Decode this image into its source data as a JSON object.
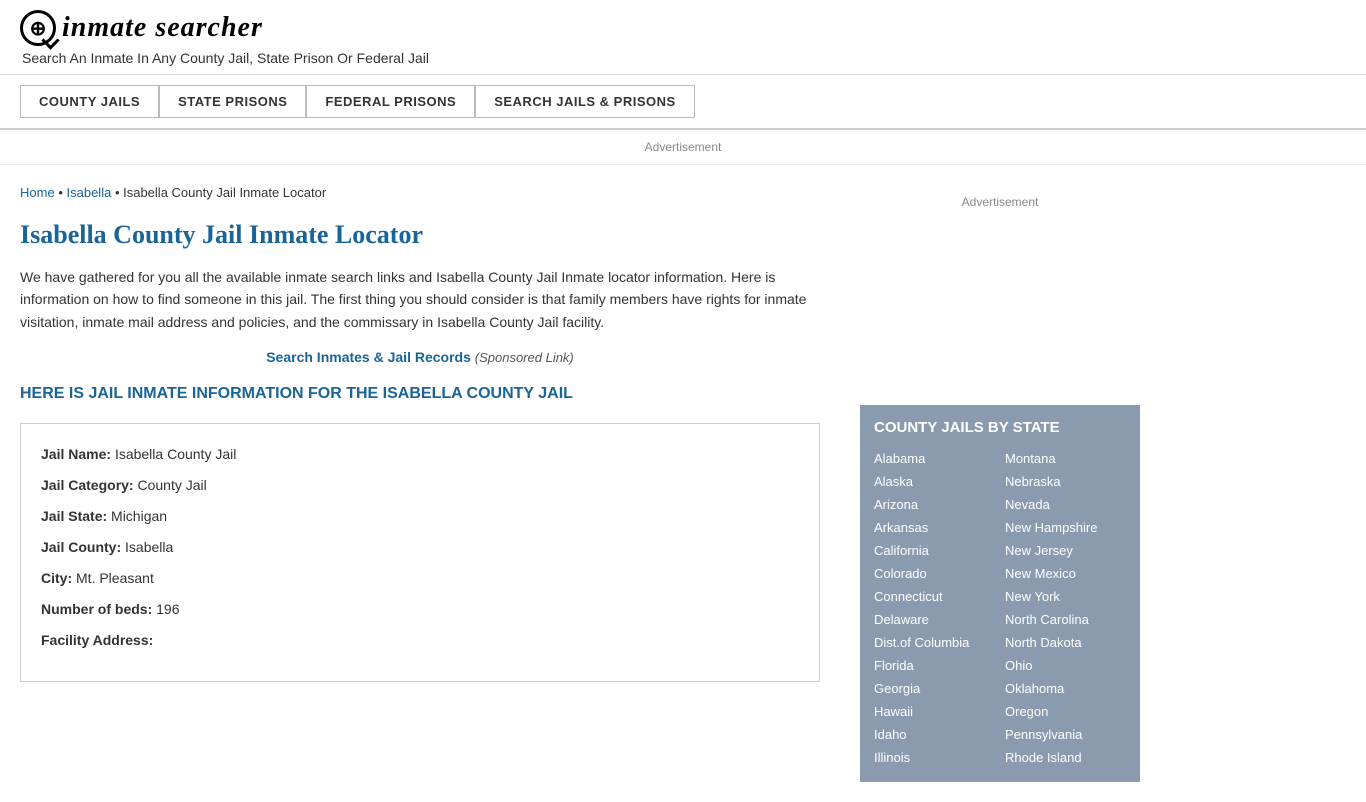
{
  "header": {
    "logo_icon": "🔍",
    "logo_text": "inmate searcher",
    "tagline": "Search An Inmate In Any County Jail, State Prison Or Federal Jail"
  },
  "nav": {
    "items": [
      {
        "label": "COUNTY JAILS",
        "href": "#"
      },
      {
        "label": "STATE PRISONS",
        "href": "#"
      },
      {
        "label": "FEDERAL PRISONS",
        "href": "#"
      },
      {
        "label": "SEARCH JAILS & PRISONS",
        "href": "#"
      }
    ]
  },
  "ad": {
    "label": "Advertisement"
  },
  "breadcrumb": {
    "home": "Home",
    "sep1": "•",
    "isabella": "Isabella",
    "sep2": "•",
    "current": "Isabella County Jail Inmate Locator"
  },
  "main": {
    "page_title": "Isabella County Jail Inmate Locator",
    "description": "We have gathered for you all the available inmate search links and Isabella County Jail Inmate locator information. Here is information on how to find someone in this jail. The first thing you should consider is that family members have rights for inmate visitation, inmate mail address and policies, and the commissary in Isabella County Jail facility.",
    "sponsored_link_text": "Search Inmates & Jail Records",
    "sponsored_suffix": "(Sponsored Link)",
    "jail_info_header": "HERE IS JAIL INMATE INFORMATION FOR THE ISABELLA COUNTY JAIL",
    "info_card": {
      "jail_name_label": "Jail Name:",
      "jail_name_value": "Isabella County Jail",
      "jail_category_label": "Jail Category:",
      "jail_category_value": "County Jail",
      "jail_state_label": "Jail State:",
      "jail_state_value": "Michigan",
      "jail_county_label": "Jail County:",
      "jail_county_value": "Isabella",
      "city_label": "City:",
      "city_value": "Mt. Pleasant",
      "beds_label": "Number of beds:",
      "beds_value": "196",
      "address_label": "Facility Address:"
    }
  },
  "sidebar": {
    "ad_label": "Advertisement",
    "county_jails_title": "COUNTY JAILS BY STATE",
    "states_left": [
      "Alabama",
      "Alaska",
      "Arizona",
      "Arkansas",
      "California",
      "Colorado",
      "Connecticut",
      "Delaware",
      "Dist.of Columbia",
      "Florida",
      "Georgia",
      "Hawaii",
      "Idaho",
      "Illinois"
    ],
    "states_right": [
      "Montana",
      "Nebraska",
      "Nevada",
      "New Hampshire",
      "New Jersey",
      "New Mexico",
      "New York",
      "North Carolina",
      "North Dakota",
      "Ohio",
      "Oklahoma",
      "Oregon",
      "Pennsylvania",
      "Rhode Island"
    ]
  }
}
